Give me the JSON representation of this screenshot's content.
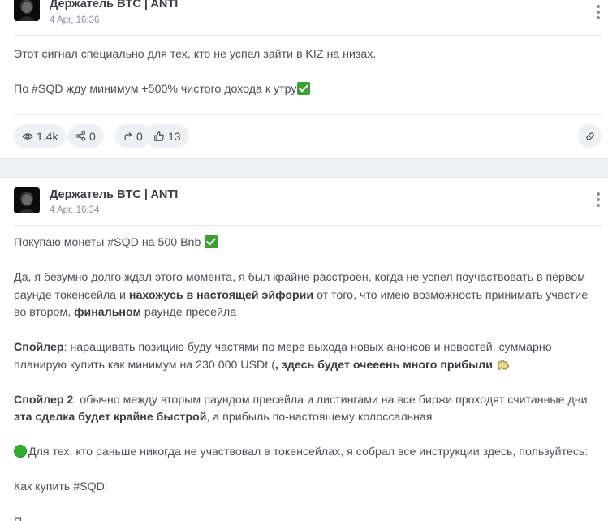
{
  "posts": [
    {
      "author": "Держатель BTC | ANTI",
      "date": "4 Apr, 16:36",
      "lines": [
        "Этот сигнал специально для тех, кто не успел зайти в KIZ на низах.",
        "По #SQD жду минимум +500% чистого дохода к утру"
      ],
      "stats": {
        "views": "1.4k",
        "shares": "0",
        "forwards": "0",
        "likes": "13"
      }
    },
    {
      "author": "Держатель BTC | ANTI",
      "date": "4 Apr, 16:34",
      "line1": "Покупаю монеты #SQD на 500 Bnb",
      "para2": {
        "a": "Да, я безумно долго ждал этого момента, я был крайне расстроен, когда не успел поучаствовать в первом раунде токенсейла и ",
        "b": "нахожусь в настоящей эйфории",
        "c": " от того, что имею возможность принимать участие во втором, ",
        "d": "финальном",
        "e": " раунде пресейла"
      },
      "para3": {
        "a": "Спойлер",
        "b": ": наращивать позицию буду частями по мере выхода новых анонсов и новостей, суммарно планирую купить как минимум на 230 000 USDt (",
        "c": ", здесь будет очееень много прибыли"
      },
      "para4": {
        "a": "Спойлер 2",
        "b": ": обычно между вторым раундом пресейла и листингами на все биржи проходят считанные дни, ",
        "c": "эта сделка будет крайне быстрой",
        "d": ", а прибыль по-настоящему колоссальная"
      },
      "para5": "Для тех, кто раньше никогда не участвовал в токенсейлах, я собрал все инструкции здесь, пользуйтесь:",
      "para6": "Как купить #SQD:",
      "para7": "П"
    }
  ],
  "icons": {
    "views": "eye-icon",
    "shares": "share-icon",
    "forwards": "forward-arrow-icon",
    "likes": "thumbs-up-icon",
    "link": "link-icon",
    "menu": "kebab-menu-icon",
    "check": "check-mark-emoji",
    "circle": "green-circle-emoji",
    "puzzle": "puzzle-piece-emoji"
  }
}
